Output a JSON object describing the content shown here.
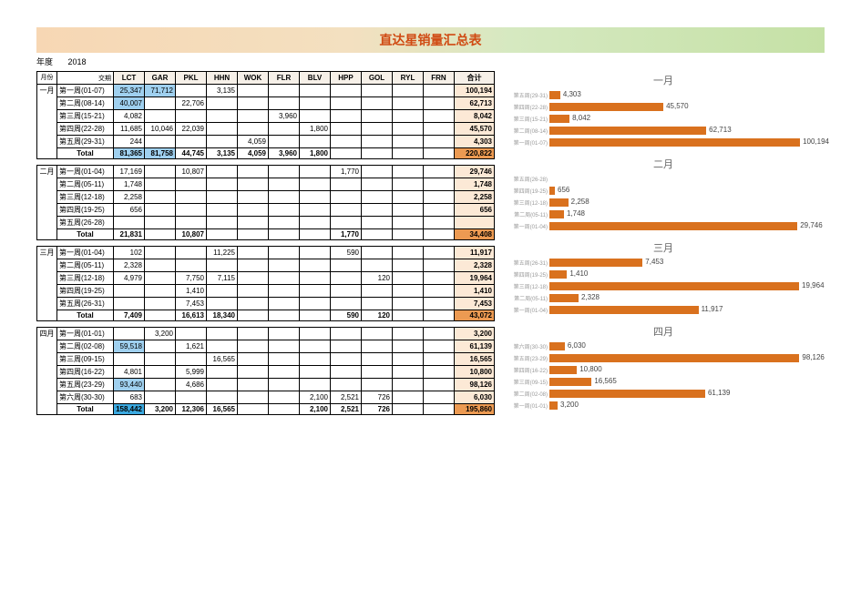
{
  "title": "直达星销量汇总表",
  "year_label": "年度",
  "year_value": "2018",
  "header": {
    "month": "月份",
    "date": "交期",
    "cols": [
      "LCT",
      "GAR",
      "PKL",
      "HHN",
      "WOK",
      "FLR",
      "BLV",
      "HPP",
      "GOL",
      "RYL",
      "FRN"
    ],
    "total": "合计"
  },
  "months": [
    {
      "name": "一月",
      "rows": [
        {
          "week": "第一周(01-07)",
          "cells": [
            "25,347",
            "71,712",
            "",
            "3,135",
            "",
            "",
            "",
            "",
            "",
            "",
            ""
          ],
          "hl": [
            0,
            1
          ],
          "sum": "100,194"
        },
        {
          "week": "第二周(08-14)",
          "cells": [
            "40,007",
            "",
            "22,706",
            "",
            "",
            "",
            "",
            "",
            "",
            "",
            ""
          ],
          "hl": [
            0
          ],
          "sum": "62,713"
        },
        {
          "week": "第三周(15-21)",
          "cells": [
            "4,082",
            "",
            "",
            "",
            "",
            "3,960",
            "",
            "",
            "",
            "",
            ""
          ],
          "hl": [],
          "sum": "8,042"
        },
        {
          "week": "第四周(22-28)",
          "cells": [
            "11,685",
            "10,046",
            "22,039",
            "",
            "",
            "",
            "1,800",
            "",
            "",
            "",
            ""
          ],
          "hl": [],
          "sum": "45,570"
        },
        {
          "week": "第五周(29-31)",
          "cells": [
            "244",
            "",
            "",
            "",
            "4,059",
            "",
            "",
            "",
            "",
            "",
            ""
          ],
          "hl": [],
          "sum": "4,303"
        }
      ],
      "total": {
        "cells": [
          "81,365",
          "81,758",
          "44,745",
          "3,135",
          "4,059",
          "3,960",
          "1,800",
          "",
          "",
          "",
          ""
        ],
        "hl": [
          0,
          1
        ],
        "sum": "220,822"
      }
    },
    {
      "name": "二月",
      "rows": [
        {
          "week": "第一周(01-04)",
          "cells": [
            "17,169",
            "",
            "10,807",
            "",
            "",
            "",
            "",
            "1,770",
            "",
            "",
            ""
          ],
          "hl": [],
          "sum": "29,746"
        },
        {
          "week": "第二周(05-11)",
          "cells": [
            "1,748",
            "",
            "",
            "",
            "",
            "",
            "",
            "",
            "",
            "",
            ""
          ],
          "hl": [],
          "sum": "1,748"
        },
        {
          "week": "第三周(12-18)",
          "cells": [
            "2,258",
            "",
            "",
            "",
            "",
            "",
            "",
            "",
            "",
            "",
            ""
          ],
          "hl": [],
          "sum": "2,258"
        },
        {
          "week": "第四周(19-25)",
          "cells": [
            "656",
            "",
            "",
            "",
            "",
            "",
            "",
            "",
            "",
            "",
            ""
          ],
          "hl": [],
          "sum": "656"
        },
        {
          "week": "第五周(26-28)",
          "cells": [
            "",
            "",
            "",
            "",
            "",
            "",
            "",
            "",
            "",
            "",
            ""
          ],
          "hl": [],
          "sum": ""
        }
      ],
      "total": {
        "cells": [
          "21,831",
          "",
          "10,807",
          "",
          "",
          "",
          "",
          "1,770",
          "",
          "",
          ""
        ],
        "hl": [],
        "sum": "34,408"
      }
    },
    {
      "name": "三月",
      "rows": [
        {
          "week": "第一周(01-04)",
          "cells": [
            "102",
            "",
            "",
            "11,225",
            "",
            "",
            "",
            "590",
            "",
            "",
            ""
          ],
          "hl": [],
          "sum": "11,917"
        },
        {
          "week": "第二周(05-11)",
          "cells": [
            "2,328",
            "",
            "",
            "",
            "",
            "",
            "",
            "",
            "",
            "",
            ""
          ],
          "hl": [],
          "sum": "2,328"
        },
        {
          "week": "第三周(12-18)",
          "cells": [
            "4,979",
            "",
            "7,750",
            "7,115",
            "",
            "",
            "",
            "",
            "120",
            "",
            ""
          ],
          "hl": [],
          "sum": "19,964"
        },
        {
          "week": "第四周(19-25)",
          "cells": [
            "",
            "",
            "1,410",
            "",
            "",
            "",
            "",
            "",
            "",
            "",
            ""
          ],
          "hl": [],
          "sum": "1,410"
        },
        {
          "week": "第五周(26-31)",
          "cells": [
            "",
            "",
            "7,453",
            "",
            "",
            "",
            "",
            "",
            "",
            "",
            ""
          ],
          "hl": [],
          "sum": "7,453"
        }
      ],
      "total": {
        "cells": [
          "7,409",
          "",
          "16,613",
          "18,340",
          "",
          "",
          "",
          "590",
          "120",
          "",
          ""
        ],
        "hl": [],
        "sum": "43,072"
      }
    },
    {
      "name": "四月",
      "rows": [
        {
          "week": "第一周(01-01)",
          "cells": [
            "",
            "3,200",
            "",
            "",
            "",
            "",
            "",
            "",
            "",
            "",
            ""
          ],
          "hl": [],
          "sum": "3,200"
        },
        {
          "week": "第二周(02-08)",
          "cells": [
            "59,518",
            "",
            "1,621",
            "",
            "",
            "",
            "",
            "",
            "",
            "",
            ""
          ],
          "hl": [
            0
          ],
          "sum": "61,139"
        },
        {
          "week": "第三周(09-15)",
          "cells": [
            "",
            "",
            "",
            "16,565",
            "",
            "",
            "",
            "",
            "",
            "",
            ""
          ],
          "hl": [],
          "sum": "16,565"
        },
        {
          "week": "第四周(16-22)",
          "cells": [
            "4,801",
            "",
            "5,999",
            "",
            "",
            "",
            "",
            "",
            "",
            "",
            ""
          ],
          "hl": [],
          "sum": "10,800"
        },
        {
          "week": "第五周(23-29)",
          "cells": [
            "93,440",
            "",
            "4,686",
            "",
            "",
            "",
            "",
            "",
            "",
            "",
            ""
          ],
          "hl": [
            0
          ],
          "sum": "98,126"
        },
        {
          "week": "第六周(30-30)",
          "cells": [
            "683",
            "",
            "",
            "",
            "",
            "",
            "2,100",
            "2,521",
            "726",
            "",
            ""
          ],
          "hl": [],
          "sum": "6,030"
        }
      ],
      "total": {
        "cells": [
          "158,442",
          "3,200",
          "12,306",
          "16,565",
          "",
          "",
          "2,100",
          "2,521",
          "726",
          "",
          ""
        ],
        "hl": [
          0
        ],
        "sum": "195,860",
        "deep": true
      }
    }
  ],
  "chart_data": [
    {
      "type": "bar",
      "title": "一月",
      "max": 110000,
      "series": [
        {
          "name": "第五周(29-31)",
          "value": 4303,
          "label": "4,303"
        },
        {
          "name": "第四周(22-28)",
          "value": 45570,
          "label": "45,570"
        },
        {
          "name": "第三周(15-21)",
          "value": 8042,
          "label": "8,042"
        },
        {
          "name": "第二周(08-14)",
          "value": 62713,
          "label": "62,713"
        },
        {
          "name": "第一周(01-07)",
          "value": 100194,
          "label": "100,194"
        }
      ]
    },
    {
      "type": "bar",
      "title": "二月",
      "max": 33000,
      "series": [
        {
          "name": "第五周(26-28)",
          "value": 0,
          "label": ""
        },
        {
          "name": "第四周(19-25)",
          "value": 656,
          "label": "656"
        },
        {
          "name": "第三周(12-18)",
          "value": 2258,
          "label": "2,258"
        },
        {
          "name": "第二周(05-11)",
          "value": 1748,
          "label": "1,748"
        },
        {
          "name": "第一周(01-04)",
          "value": 29746,
          "label": "29,746"
        }
      ]
    },
    {
      "type": "bar",
      "title": "三月",
      "max": 22000,
      "series": [
        {
          "name": "第五周(26-31)",
          "value": 7453,
          "label": "7,453"
        },
        {
          "name": "第四周(19-25)",
          "value": 1410,
          "label": "1,410"
        },
        {
          "name": "第三周(12-18)",
          "value": 19964,
          "label": "19,964"
        },
        {
          "name": "第二周(05-11)",
          "value": 2328,
          "label": "2,328"
        },
        {
          "name": "第一周(01-04)",
          "value": 11917,
          "label": "11,917"
        }
      ]
    },
    {
      "type": "bar",
      "title": "四月",
      "max": 108000,
      "series": [
        {
          "name": "第六周(30-30)",
          "value": 6030,
          "label": "6,030"
        },
        {
          "name": "第五周(23-29)",
          "value": 98126,
          "label": "98,126"
        },
        {
          "name": "第四周(16-22)",
          "value": 10800,
          "label": "10,800"
        },
        {
          "name": "第三周(09-15)",
          "value": 16565,
          "label": "16,565"
        },
        {
          "name": "第二周(02-08)",
          "value": 61139,
          "label": "61,139"
        },
        {
          "name": "第一周(01-01)",
          "value": 3200,
          "label": "3,200"
        }
      ]
    }
  ],
  "labels": {
    "total": "Total"
  }
}
